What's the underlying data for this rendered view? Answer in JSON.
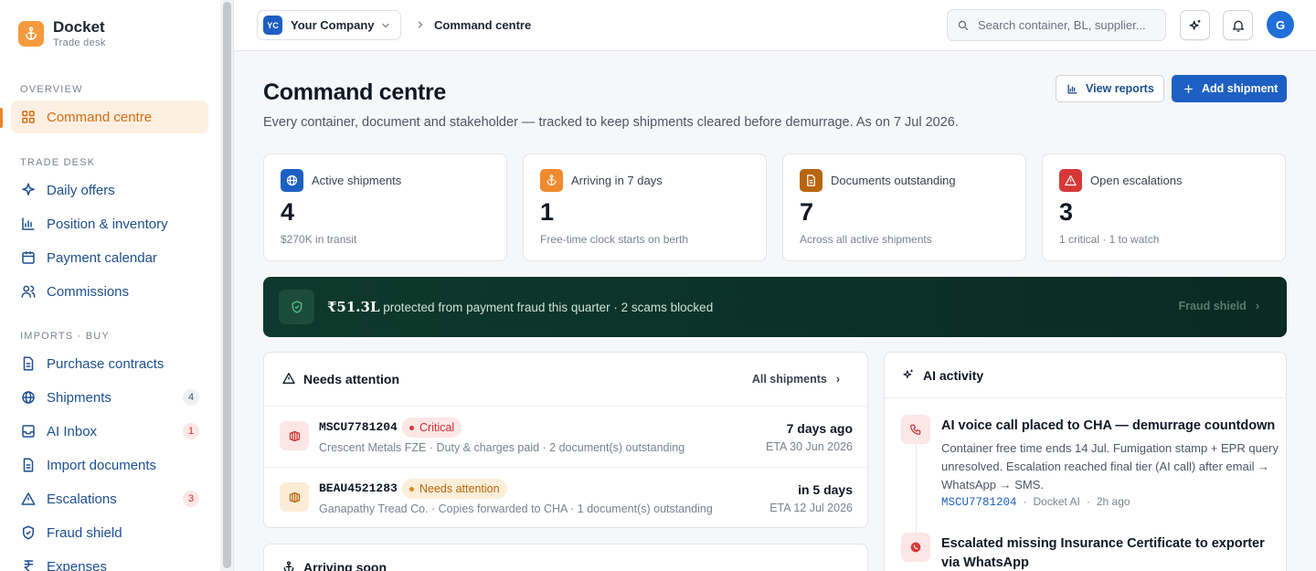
{
  "brand": {
    "name": "Docket",
    "sub": "Trade desk"
  },
  "sidebar": {
    "sections": [
      "OVERVIEW",
      "TRADE DESK",
      "IMPORTS · BUY"
    ],
    "items": [
      {
        "label": "Command centre"
      },
      {
        "label": "Daily offers"
      },
      {
        "label": "Position & inventory"
      },
      {
        "label": "Payment calendar"
      },
      {
        "label": "Commissions"
      },
      {
        "label": "Purchase contracts"
      },
      {
        "label": "Shipments",
        "badge": "4"
      },
      {
        "label": "AI Inbox",
        "badge": "1"
      },
      {
        "label": "Import documents"
      },
      {
        "label": "Escalations",
        "badge": "3"
      },
      {
        "label": "Fraud shield"
      },
      {
        "label": "Expenses"
      }
    ]
  },
  "topbar": {
    "company_initials": "YC",
    "company": "Your Company",
    "breadcrumb": "Command centre",
    "search_placeholder": "Search container, BL, supplier...",
    "avatar": "G"
  },
  "page": {
    "title": "Command centre",
    "subtitle": "Every container, document and stakeholder — tracked to keep shipments cleared before demurrage. As on 7 Jul 2026.",
    "view_reports": "View reports",
    "add_shipment": "Add shipment"
  },
  "stats": [
    {
      "label": "Active shipments",
      "value": "4",
      "sub": "$270K in transit",
      "icon": "globe-icon",
      "color": "#1d5fc2"
    },
    {
      "label": "Arriving in 7 days",
      "value": "1",
      "sub": "Free-time clock starts on berth",
      "icon": "anchor-icon",
      "color": "#ef8a2f"
    },
    {
      "label": "Documents outstanding",
      "value": "7",
      "sub": "Across all active shipments",
      "icon": "document-icon",
      "color": "#b8650f"
    },
    {
      "label": "Open escalations",
      "value": "3",
      "sub": "1 critical · 1 to watch",
      "icon": "warning-icon",
      "color": "#d63838"
    }
  ],
  "fraud_banner": {
    "amount": "₹51.3L",
    "text": " protected from payment fraud this quarter · 2 scams blocked",
    "link": "Fraud shield"
  },
  "attention": {
    "title": "Needs attention",
    "link": "All shipments",
    "rows": [
      {
        "code": "MSCU7781204",
        "status": "Critical",
        "desc": "Crescent Metals FZE · Duty & charges paid · 2 document(s) outstanding",
        "when": "7 days ago",
        "eta": "ETA 30 Jun 2026"
      },
      {
        "code": "BEAU4521283",
        "status": "Needs attention",
        "desc": "Ganapathy Tread Co. · Copies forwarded to CHA · 1 document(s) outstanding",
        "when": "in 5 days",
        "eta": "ETA 12 Jul 2026"
      }
    ]
  },
  "arriving": {
    "title": "Arriving soon"
  },
  "ai_activity": {
    "title": "AI activity",
    "items": [
      {
        "title": "AI voice call placed to CHA — demurrage countdown",
        "body": "Container free time ends 14 Jul. Fumigation stamp + EPR query unresolved. Escalation reached final tier (AI call) after email → WhatsApp → SMS.",
        "ref": "MSCU7781204",
        "source": "Docket AI",
        "time": "2h ago"
      },
      {
        "title": "Escalated missing Insurance Certificate to exporter via WhatsApp"
      }
    ]
  },
  "colors": {
    "accent": "#1d5fc2",
    "brand": "#f59a3c",
    "critical": "#d63838",
    "warning": "#c8740f",
    "banner": "#0d3a2c"
  }
}
